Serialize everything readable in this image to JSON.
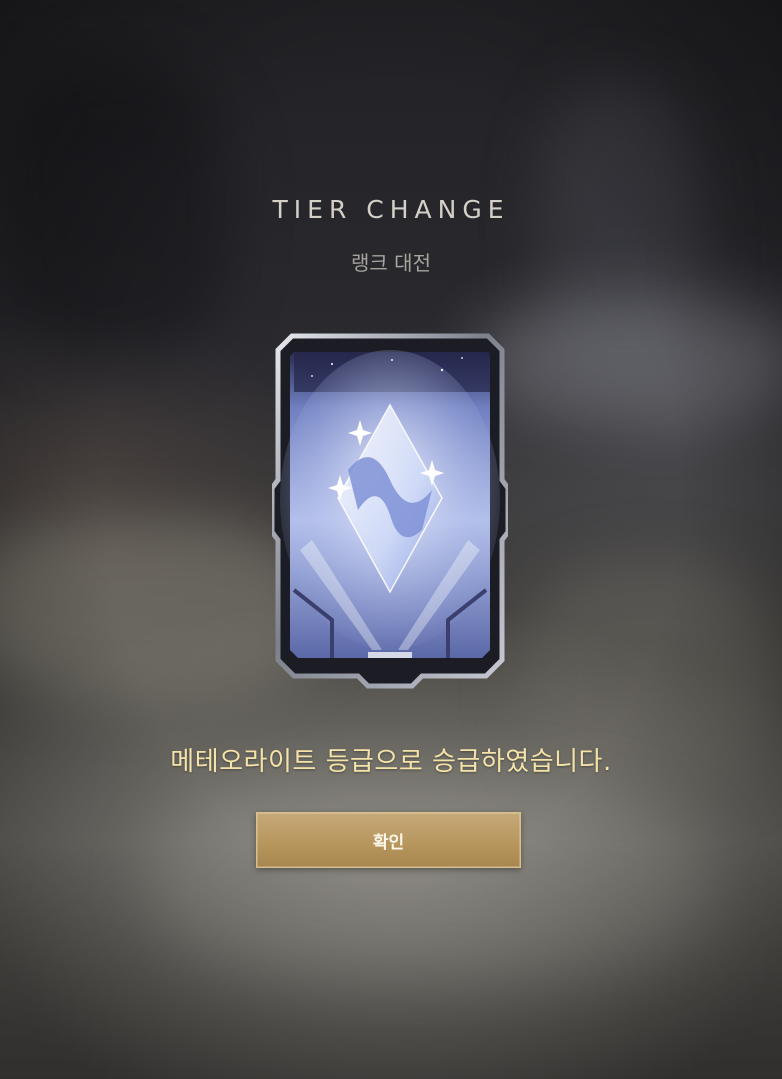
{
  "dialog": {
    "title": "TIER CHANGE",
    "subtitle": "랭크 대전",
    "message": "메테오라이트 등급으로 승급하였습니다.",
    "confirm_label": "확인"
  },
  "tier_card": {
    "icon": "meteorite-tier-emblem-icon",
    "accent_color": "#9fb2e6"
  },
  "colors": {
    "message": "#f4e3a8",
    "button": "#b8975f",
    "title": "#d4d0c8"
  }
}
